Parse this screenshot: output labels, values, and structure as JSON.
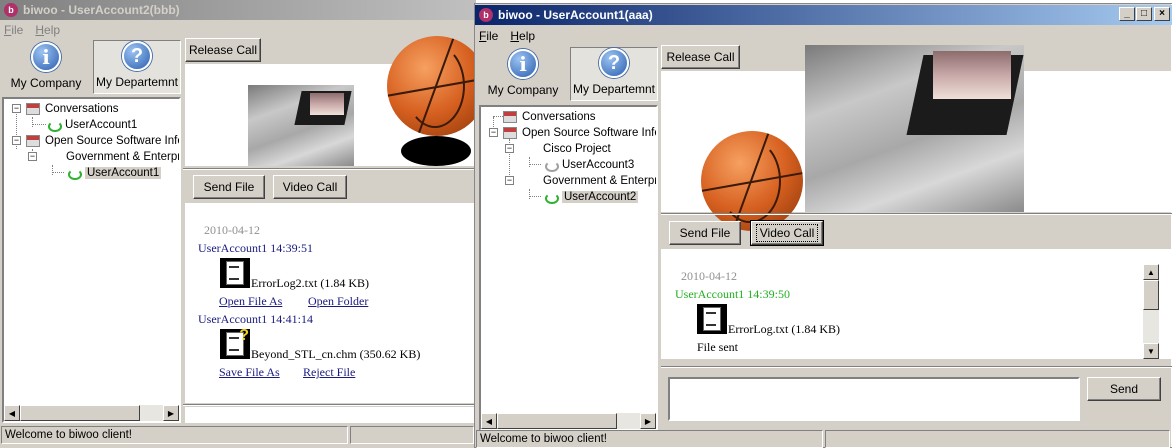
{
  "window1": {
    "title": "biwoo - UserAccount2(bbb)",
    "app_icon": "biwoo-app-icon",
    "menu": [
      {
        "label": "File",
        "accel": "F",
        "rest": "ile"
      },
      {
        "label": "Help",
        "accel": "H",
        "rest": "elp"
      }
    ],
    "toolbar": {
      "company_label": "My Company",
      "department_label": "My Departemnt"
    },
    "tree": {
      "conversations": "Conversations",
      "conv_user": "UserAccount1",
      "org": "Open Source Software Infer",
      "dept": "Government & Enterpris",
      "dept_user": "UserAccount1"
    },
    "release_call": "Release Call",
    "send_file": "Send File",
    "video_call": "Video Call",
    "chat": {
      "date": "2010-04-12",
      "msg1_user": "UserAccount1 14:39:51",
      "msg1_file": "ErrorLog2.txt (1.84 KB)",
      "msg1_link1": "Open File As",
      "msg1_link2": "Open Folder",
      "msg2_user": "UserAccount1 14:41:14",
      "msg2_file": "Beyond_STL_cn.chm (350.62 KB)",
      "msg2_link1": "Save File As",
      "msg2_link2": "Reject File"
    },
    "status": "Welcome to biwoo client!"
  },
  "window2": {
    "title": "biwoo - UserAccount1(aaa)",
    "app_icon": "biwoo-app-icon",
    "menu": [
      {
        "label": "File",
        "accel": "F",
        "rest": "ile"
      },
      {
        "label": "Help",
        "accel": "H",
        "rest": "elp"
      }
    ],
    "toolbar": {
      "company_label": "My Company",
      "department_label": "My Departemnt"
    },
    "tree": {
      "conversations": "Conversations",
      "org": "Open Source Software Infer",
      "cisco": "Cisco Project",
      "cisco_user": "UserAccount3",
      "dept": "Government & Enterpris",
      "dept_user": "UserAccount2"
    },
    "release_call": "Release Call",
    "send_file": "Send File",
    "video_call": "Video Call",
    "send": "Send",
    "chat": {
      "date": "2010-04-12",
      "msg1_user": "UserAccount1 14:39:50",
      "msg1_file": "ErrorLog.txt (1.84 KB)",
      "msg1_status": "File sent"
    },
    "status": "Welcome to biwoo client!",
    "window_controls": [
      "minimize-icon",
      "maximize-icon",
      "close-icon"
    ]
  }
}
